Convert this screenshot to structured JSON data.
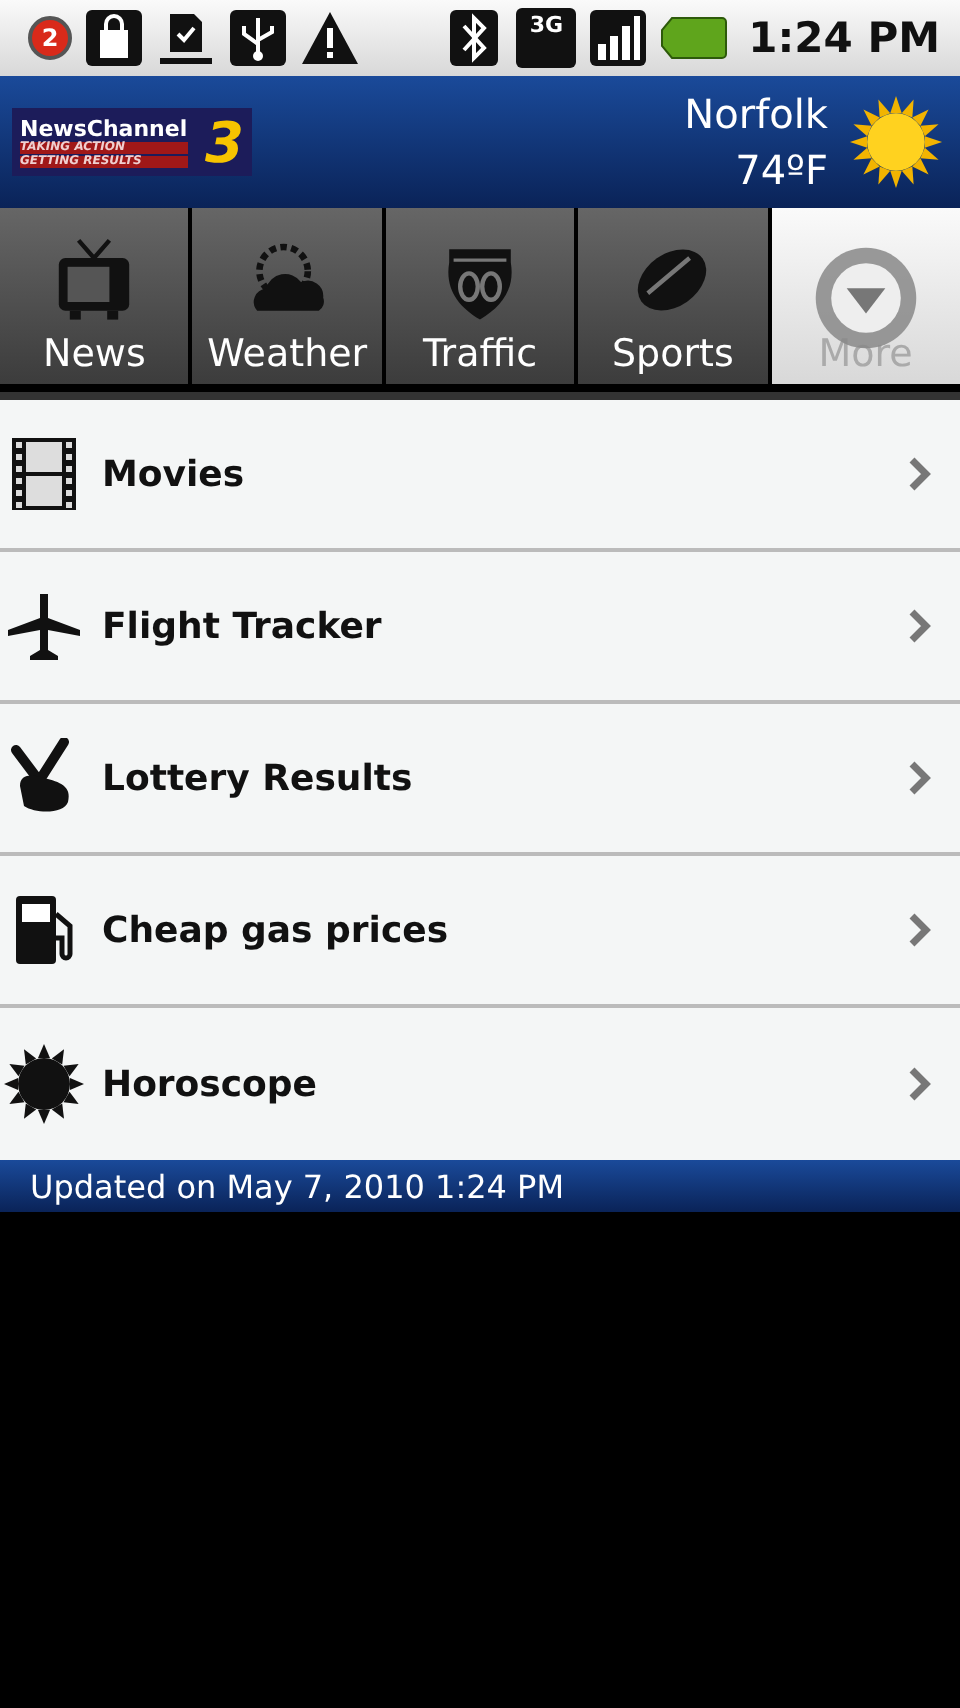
{
  "status_bar": {
    "notification_count": "2",
    "network": "3G",
    "time": "1:24 PM"
  },
  "header": {
    "logo": {
      "name": "NewsChannel",
      "number": "3",
      "tagline_1": "TAKING ACTION",
      "tagline_2": "GETTING RESULTS"
    },
    "city": "Norfolk",
    "temperature": "74ºF"
  },
  "tabs": [
    {
      "label": "News",
      "kind": "tv",
      "selected": false
    },
    {
      "label": "Weather",
      "kind": "weather",
      "selected": false
    },
    {
      "label": "Traffic",
      "kind": "route",
      "selected": false
    },
    {
      "label": "Sports",
      "kind": "football",
      "selected": false
    },
    {
      "label": "More",
      "kind": "more",
      "selected": true
    }
  ],
  "items": [
    {
      "label": "Movies",
      "kind": "film"
    },
    {
      "label": "Flight Tracker",
      "kind": "plane"
    },
    {
      "label": "Lottery Results",
      "kind": "fingers"
    },
    {
      "label": "Cheap gas prices",
      "kind": "gas"
    },
    {
      "label": "Horoscope",
      "kind": "sunmoon"
    }
  ],
  "footer": "Updated on May 7, 2010 1:24 PM"
}
